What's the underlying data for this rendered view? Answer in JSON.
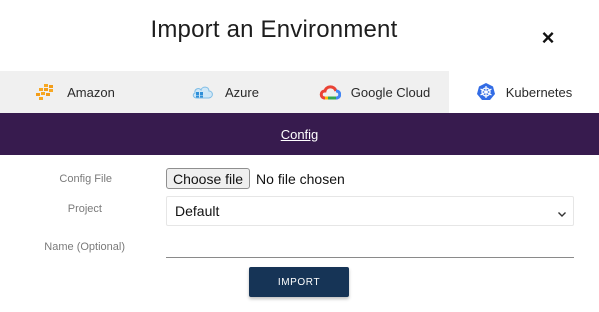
{
  "modal": {
    "title": "Import an Environment",
    "close_label": "×"
  },
  "tabs": [
    {
      "label": "Amazon",
      "icon": "aws-icon"
    },
    {
      "label": "Azure",
      "icon": "azure-cloud-icon"
    },
    {
      "label": "Google Cloud",
      "icon": "google-cloud-icon"
    },
    {
      "label": "Kubernetes",
      "icon": "kubernetes-icon",
      "active": true
    }
  ],
  "subnav": {
    "link_label": "Config"
  },
  "form": {
    "config_file_label": "Config File",
    "choose_file_label": "Choose file",
    "file_status": "No file chosen",
    "project_label": "Project",
    "project_value": "Default",
    "name_label": "Name (Optional)",
    "name_value": ""
  },
  "actions": {
    "import_label": "IMPORT"
  },
  "colors": {
    "subnav_bg": "#371b4e",
    "tab_bar_bg": "#f0f0f0",
    "import_button_bg": "#163456"
  }
}
